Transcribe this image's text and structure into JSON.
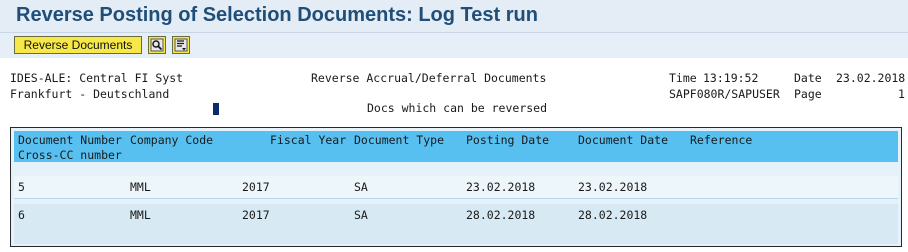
{
  "window": {
    "title": "Reverse Posting of Selection Documents: Log Test run"
  },
  "toolbar": {
    "reverse_label": "Reverse Documents",
    "icons": [
      "search-icon",
      "document-settings-icon"
    ]
  },
  "report_header": {
    "line1_left": "IDES-ALE: Central FI Syst",
    "line1_center": "Reverse Accrual/Deferral Documents",
    "time_label": "Time",
    "time_value": "13:19:52",
    "date_label": "Date",
    "date_value": "23.02.2018",
    "line2_left": "Frankfurt - Deutschland",
    "program_user": "SAPF080R/SAPUSER",
    "page_label": "Page",
    "page_value": "1",
    "subtitle": "Docs which can be reversed"
  },
  "table": {
    "columns": [
      "Document Number",
      "Company Code",
      "Fiscal Year",
      "Document Type",
      "Posting Date",
      "Document Date",
      "Reference"
    ],
    "second_header_line": "Cross-CC number",
    "rows": [
      {
        "doc_number": "5",
        "company_code": "MML",
        "fiscal_year": "2017",
        "doc_type": "SA",
        "posting_date": "23.02.2018",
        "document_date": "23.02.2018",
        "reference": ""
      },
      {
        "doc_number": "6",
        "company_code": "MML",
        "fiscal_year": "2017",
        "doc_type": "SA",
        "posting_date": "28.02.2018",
        "document_date": "28.02.2018",
        "reference": ""
      }
    ]
  },
  "colors": {
    "title": "#1f4e79",
    "header_band": "#57c0f0",
    "button": "#f7e84a"
  }
}
